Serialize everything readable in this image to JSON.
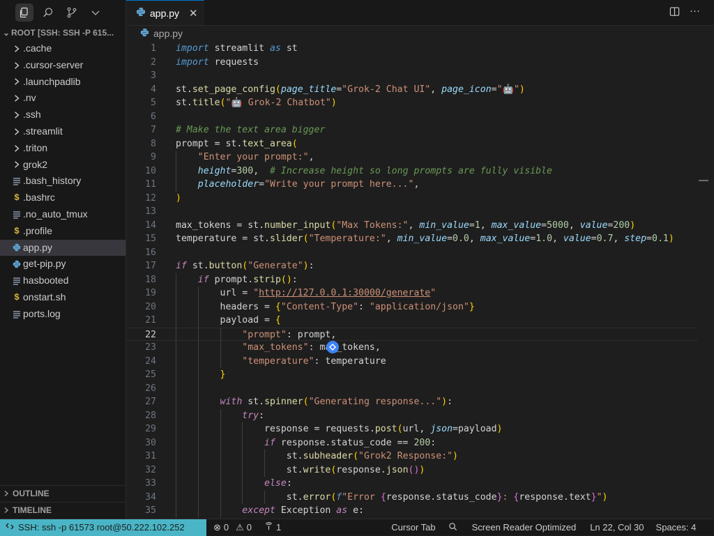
{
  "sidebar": {
    "explorer_title": "ROOT [SSH: SSH -P 615...",
    "items": [
      {
        "label": ".cache",
        "kind": "folder"
      },
      {
        "label": ".cursor-server",
        "kind": "folder"
      },
      {
        "label": ".launchpadlib",
        "kind": "folder"
      },
      {
        "label": ".nv",
        "kind": "folder"
      },
      {
        "label": ".ssh",
        "kind": "folder"
      },
      {
        "label": ".streamlit",
        "kind": "folder"
      },
      {
        "label": ".triton",
        "kind": "folder"
      },
      {
        "label": "grok2",
        "kind": "folder"
      },
      {
        "label": ".bash_history",
        "kind": "text"
      },
      {
        "label": ".bashrc",
        "kind": "shell"
      },
      {
        "label": ".no_auto_tmux",
        "kind": "text"
      },
      {
        "label": ".profile",
        "kind": "shell"
      },
      {
        "label": "app.py",
        "kind": "python"
      },
      {
        "label": "get-pip.py",
        "kind": "python"
      },
      {
        "label": "hasbooted",
        "kind": "text"
      },
      {
        "label": "onstart.sh",
        "kind": "shell"
      },
      {
        "label": "ports.log",
        "kind": "text"
      }
    ],
    "outline_label": "OUTLINE",
    "timeline_label": "TIMELINE"
  },
  "editor": {
    "tab_label": "app.py",
    "breadcrumb": "app.py",
    "current_line": 22,
    "lines": [
      "<span class=\"kw\">import</span> streamlit <span class=\"kw\">as</span> st",
      "<span class=\"kw\">import</span> requests",
      "",
      "st.<span class=\"fn\">set_page_config</span><span class=\"br1\">(</span><span class=\"param\">page_title</span>=<span class=\"str\">\"Grok-2 Chat UI\"</span>, <span class=\"param\">page_icon</span>=<span class=\"str\">\"🤖\"</span><span class=\"br1\">)</span>",
      "st.<span class=\"fn\">title</span><span class=\"br1\">(</span><span class=\"str\">\"🤖 Grok-2 Chatbot\"</span><span class=\"br1\">)</span>",
      "",
      "<span class=\"cm\"># Make the text area bigger</span>",
      "prompt = st.<span class=\"fn\">text_area</span><span class=\"br1\">(</span>",
      "    <span class=\"str\">\"Enter your prompt:\"</span>,",
      "    <span class=\"param\">height</span>=<span class=\"num\">300</span>,  <span class=\"cm\"># Increase height so long prompts are fully visible</span>",
      "    <span class=\"param\">placeholder</span>=<span class=\"str\">\"Write your prompt here...\"</span>,",
      "<span class=\"br1\">)</span>",
      "",
      "max_tokens = st.<span class=\"fn\">number_input</span><span class=\"br1\">(</span><span class=\"str\">\"Max Tokens:\"</span>, <span class=\"param\">min_value</span>=<span class=\"num\">1</span>, <span class=\"param\">max_value</span>=<span class=\"num\">5000</span>, <span class=\"param\">value</span>=<span class=\"num\">200</span><span class=\"br1\">)</span>",
      "temperature = st.<span class=\"fn\">slider</span><span class=\"br1\">(</span><span class=\"str\">\"Temperature:\"</span>, <span class=\"param\">min_value</span>=<span class=\"num\">0.0</span>, <span class=\"param\">max_value</span>=<span class=\"num\">1.0</span>, <span class=\"param\">value</span>=<span class=\"num\">0.7</span>, <span class=\"param\">step</span>=<span class=\"num\">0.1</span><span class=\"br1\">)</span>",
      "",
      "<span class=\"ctl\">if</span> st.<span class=\"fn\">button</span><span class=\"br1\">(</span><span class=\"str\">\"Generate\"</span><span class=\"br1\">)</span>:",
      "    <span class=\"ctl\">if</span> prompt.<span class=\"fn\">strip</span><span class=\"br1\">()</span>:",
      "        url = <span class=\"str\">\"<span class=\"link\">http://127.0.0.1:30000/generate</span>\"</span>",
      "        headers = <span class=\"br1\">{</span><span class=\"str\">\"Content-Type\"</span>: <span class=\"str\">\"application/json\"</span><span class=\"br1\">}</span>",
      "        payload = <span class=\"br1\">{</span>",
      "            <span class=\"str\">\"prompt\"</span>: prompt,",
      "            <span class=\"str\">\"max_tokens\"</span>: max_tokens,",
      "            <span class=\"str\">\"temperature\"</span>: temperature",
      "        <span class=\"br1\">}</span>",
      "",
      "        <span class=\"ctl\">with</span> st.<span class=\"fn\">spinner</span><span class=\"br1\">(</span><span class=\"str\">\"Generating response...\"</span><span class=\"br1\">)</span>:",
      "            <span class=\"ctl\">try</span>:",
      "                response = requests.<span class=\"fn\">post</span><span class=\"br1\">(</span>url, <span class=\"param\">json</span>=payload<span class=\"br1\">)</span>",
      "                <span class=\"ctl\">if</span> response.status_code == <span class=\"num\">200</span>:",
      "                    st.<span class=\"fn\">subheader</span><span class=\"br1\">(</span><span class=\"str\">\"Grok2 Response:\"</span><span class=\"br1\">)</span>",
      "                    st.<span class=\"fn\">write</span><span class=\"br1\">(</span>response.<span class=\"fn\">json</span><span class=\"br2\">()</span><span class=\"br1\">)</span>",
      "                <span class=\"ctl\">else</span>:",
      "                    st.<span class=\"fn\">error</span><span class=\"br1\">(</span><span class=\"kw\">f</span><span class=\"str\">\"Error </span><span class=\"br2\">{</span>response.status_code<span class=\"br2\">}</span><span class=\"str\">: </span><span class=\"br2\">{</span>response.text<span class=\"br2\">}</span><span class=\"str\">\"</span><span class=\"br1\">)</span>",
      "            <span class=\"ctl\">except</span> Exception <span class=\"ctl\">as</span> e:"
    ]
  },
  "statusbar": {
    "remote": "SSH: ssh -p 61573 root@50.222.102.252",
    "errors": "0",
    "warnings": "0",
    "ports": "1",
    "cursor_tab": "Cursor Tab",
    "screen_reader": "Screen Reader Optimized",
    "position": "Ln 22, Col 30",
    "spaces": "Spaces: 4"
  },
  "colors": {
    "remote_bg": "#4ab5c6",
    "tab_accent": "#0078d4"
  }
}
